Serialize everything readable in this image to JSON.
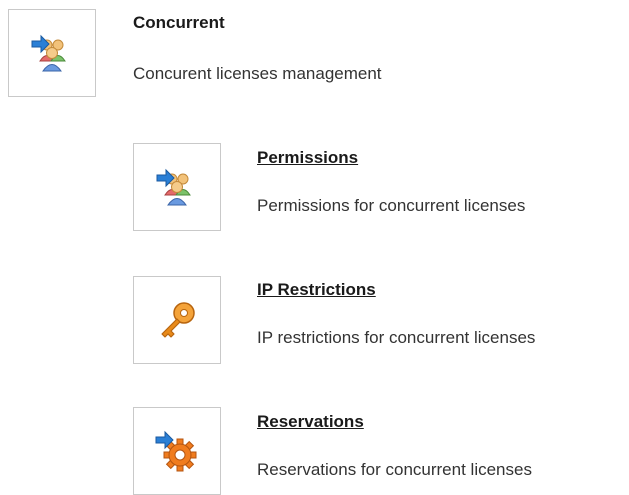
{
  "header": {
    "title": "Concurrent",
    "description": "Concurent licenses management",
    "icon": "users-arrow-icon"
  },
  "items": [
    {
      "title": "Permissions",
      "description": "Permissions for concurrent licenses",
      "icon": "users-arrow-icon"
    },
    {
      "title": "IP Restrictions",
      "description": "IP restrictions for concurrent licenses",
      "icon": "key-icon"
    },
    {
      "title": "Reservations",
      "description": "Reservations for concurrent licenses",
      "icon": "gear-arrow-icon"
    }
  ],
  "colors": {
    "arrow_blue": "#2a7fd6",
    "key_orange": "#e88a1a",
    "gear_orange": "#f07c1e",
    "border": "#c9c9c9"
  }
}
